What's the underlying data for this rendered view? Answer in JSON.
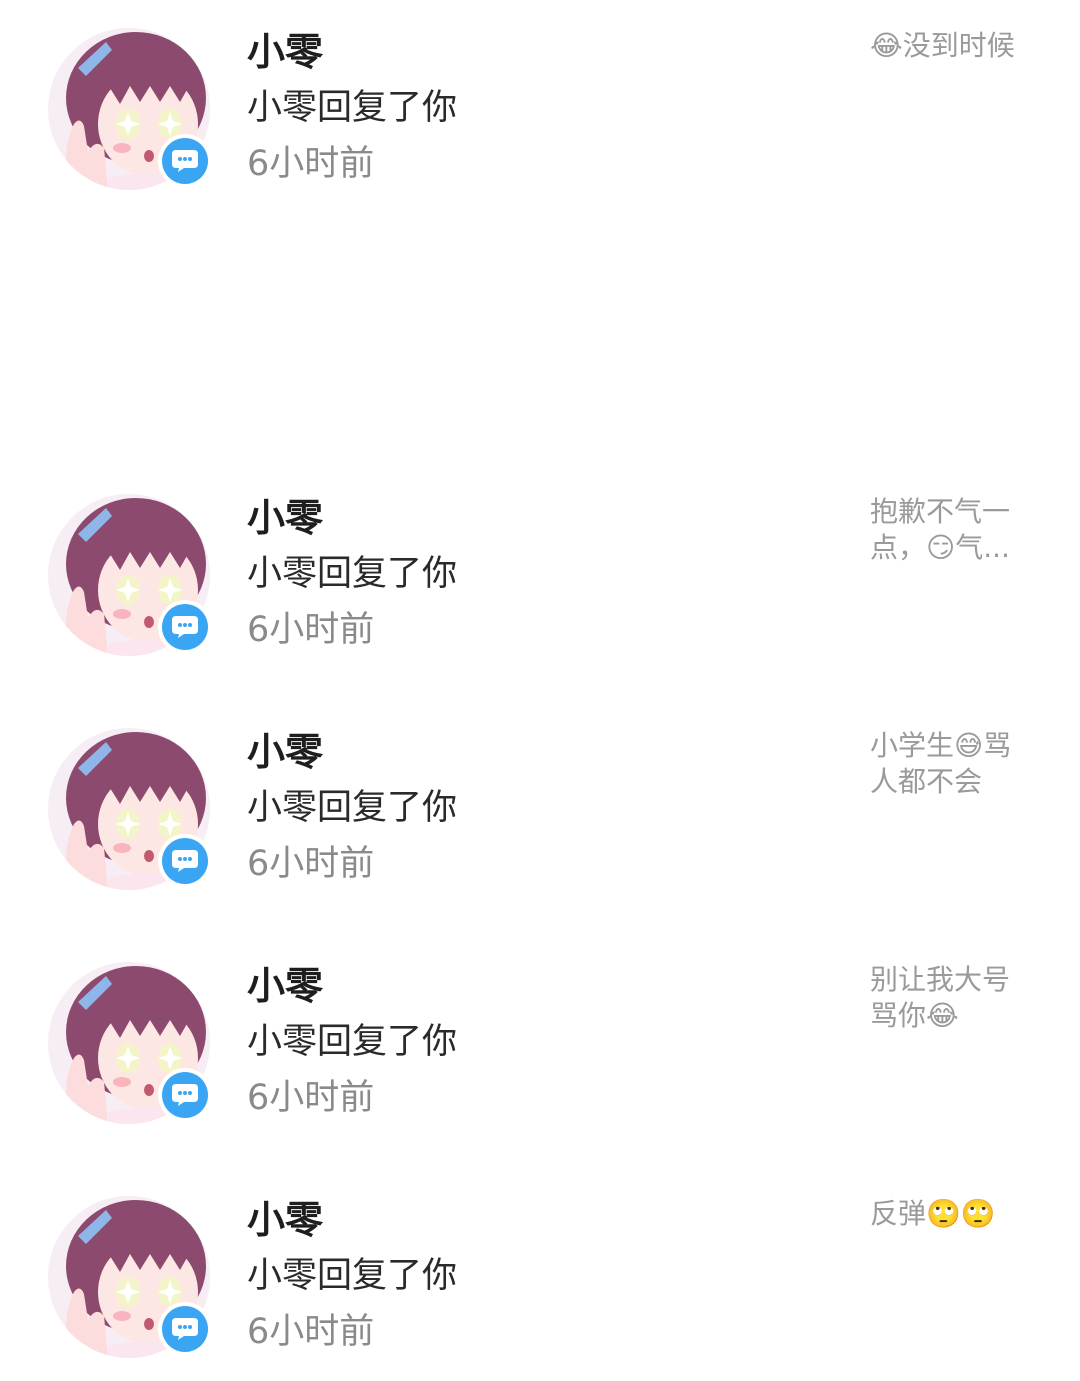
{
  "notifications": [
    {
      "name": "小零",
      "action": "小零回复了你",
      "time": "6小时前",
      "preview": "😂没到时候"
    },
    {
      "name": "小零",
      "action": "小零回复了你",
      "time": "6小时前",
      "preview": "抱歉不气一点，😏气..."
    },
    {
      "name": "小零",
      "action": "小零回复了你",
      "time": "6小时前",
      "preview": "小学生😅骂人都不会"
    },
    {
      "name": "小零",
      "action": "小零回复了你",
      "time": "6小时前",
      "preview": "别让我大号骂你😂"
    },
    {
      "name": "小零",
      "action": "小零回复了你",
      "time": "6小时前",
      "preview": "反弹🙄🙄"
    }
  ],
  "icons": {
    "avatar": "anime-girl-avatar",
    "badge": "comment-bubble-icon"
  },
  "colors": {
    "badge": "#3aa6f3",
    "name": "#1e1e1e",
    "secondary": "#8a8a8a",
    "preview": "#9a9a9a"
  }
}
